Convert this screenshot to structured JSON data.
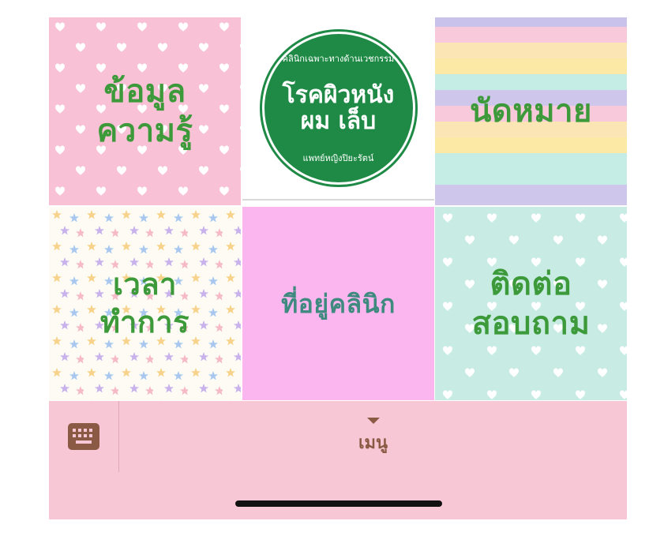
{
  "tiles": {
    "info": {
      "line1": "ข้อมูล",
      "line2": "ความรู้"
    },
    "logo": {
      "top_arc": "คลินิกเฉพาะทางด้านเวชกรรม",
      "line1": "โรคผิวหนัง",
      "line2": "ผม เล็บ",
      "bottom_arc": "แพทย์หญิงปิยะรัตน์"
    },
    "appointment": {
      "label": "นัดหมาย"
    },
    "hours": {
      "line1": "เวลา",
      "line2": "ทำการ"
    },
    "address": {
      "label": "ที่อยู่คลินิก"
    },
    "contact": {
      "line1": "ติดต่อ",
      "line2": "สอบถาม"
    }
  },
  "menu": {
    "label": "เมนู"
  },
  "icons": {
    "keyboard": "keyboard-icon",
    "menu_toggle": "caret-down-icon"
  },
  "colors": {
    "pink_tile": "#f8c1d5",
    "mint_tile": "#c8ece4",
    "magenta_tile": "#fbb6f0",
    "logo_green": "#1e8a45",
    "label_green": "#3d9a3a",
    "menu_bg": "#f7c7d5",
    "menu_text": "#8b5a45"
  }
}
